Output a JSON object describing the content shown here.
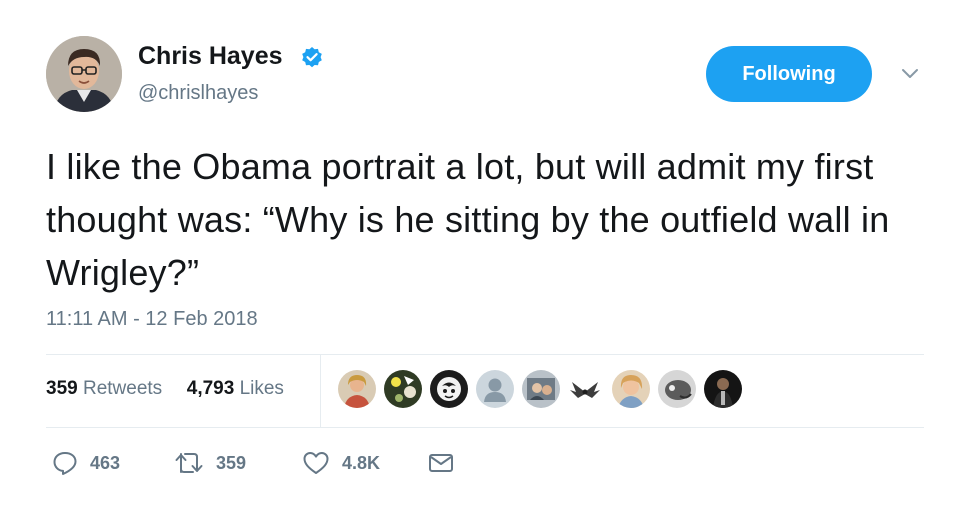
{
  "author": {
    "display_name": "Chris Hayes",
    "handle": "@chrislhayes",
    "verified": true,
    "avatar_icon": "profile-photo"
  },
  "follow_button": {
    "label": "Following",
    "color": "#1da1f2"
  },
  "caret_icon": "chevron-down-icon",
  "tweet": {
    "text": "I like the Obama portrait a lot, but will admit my first thought was: “Why is he sitting by the outfield wall in Wrigley?”",
    "timestamp": "11:11 AM - 12 Feb 2018"
  },
  "stats": {
    "retweets_count": "359",
    "retweets_label": "Retweets",
    "likes_count": "4,793",
    "likes_label": "Likes"
  },
  "likers": [
    {
      "icon": "liker-avatar-1"
    },
    {
      "icon": "liker-avatar-2"
    },
    {
      "icon": "liker-avatar-3"
    },
    {
      "icon": "liker-avatar-default"
    },
    {
      "icon": "liker-avatar-5"
    },
    {
      "icon": "liker-avatar-6"
    },
    {
      "icon": "liker-avatar-7"
    },
    {
      "icon": "liker-avatar-8"
    },
    {
      "icon": "liker-avatar-9"
    }
  ],
  "actions": {
    "reply_count": "463",
    "retweet_count": "359",
    "like_count": "4.8K",
    "icons": [
      "reply-icon",
      "retweet-icon",
      "heart-icon",
      "envelope-icon"
    ]
  },
  "colors": {
    "text": "#14171a",
    "muted": "#657786",
    "accent": "#1da1f2",
    "divider": "#e6ecf0"
  }
}
